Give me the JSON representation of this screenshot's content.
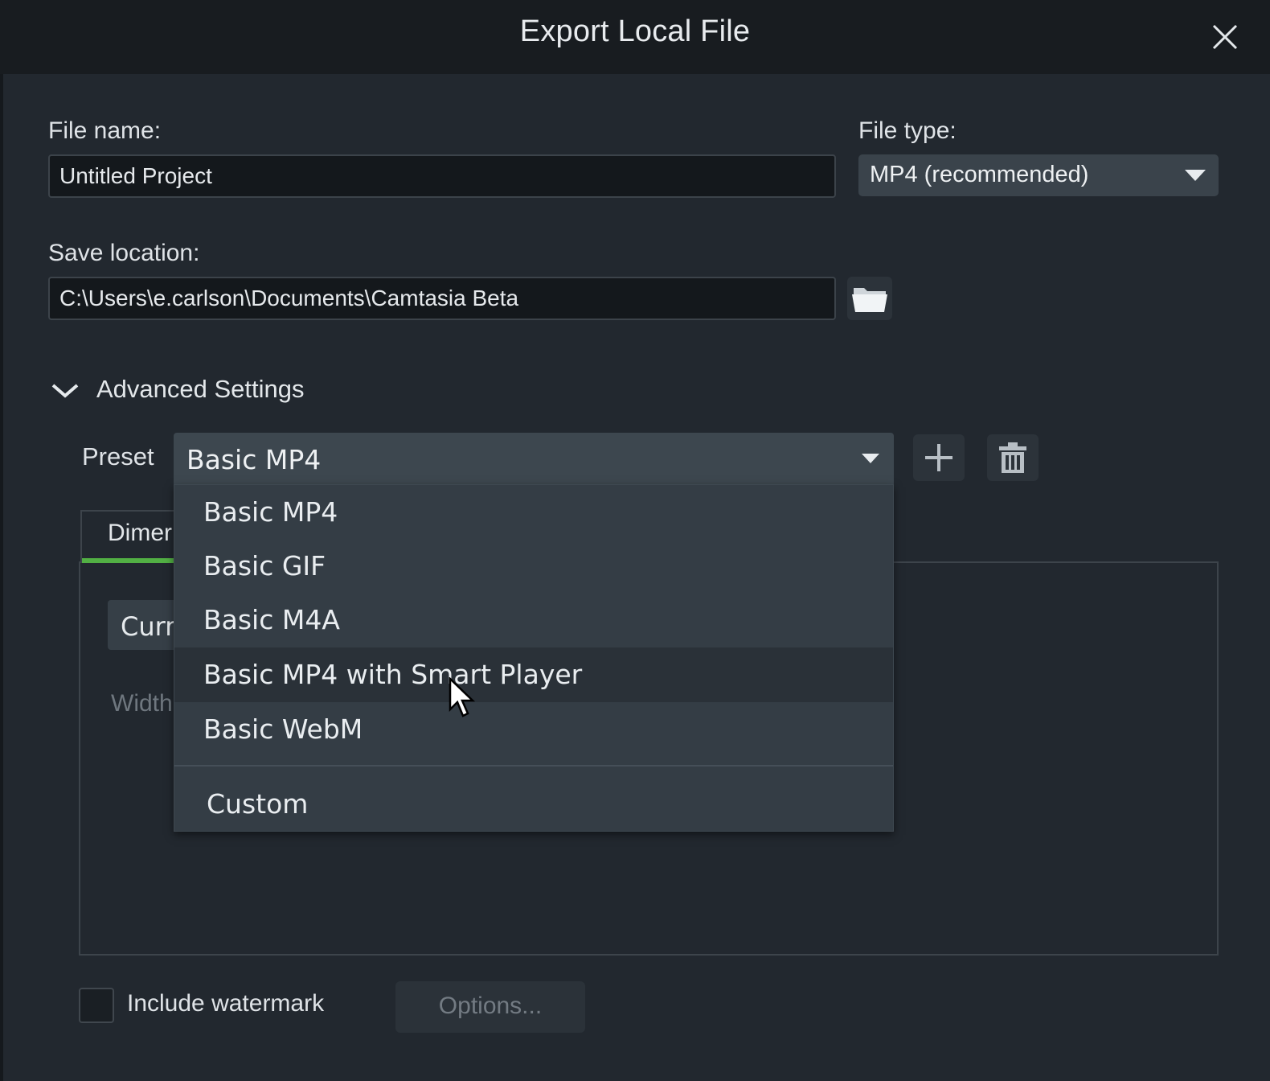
{
  "dialog": {
    "title": "Export Local File"
  },
  "file_name": {
    "label": "File name:",
    "value": "Untitled Project"
  },
  "file_type": {
    "label": "File type:",
    "selected": "MP4 (recommended)"
  },
  "save_location": {
    "label": "Save location:",
    "value": "C:\\Users\\e.carlson\\Documents\\Camtasia Beta"
  },
  "advanced": {
    "label": "Advanced Settings"
  },
  "preset": {
    "label": "Preset",
    "selected": "Basic MP4",
    "options": [
      "Basic MP4",
      "Basic GIF",
      "Basic M4A",
      "Basic MP4 with Smart Player",
      "Basic WebM",
      "Custom"
    ],
    "hovered_option": "Basic MP4 with Smart Player"
  },
  "tabs": {
    "dimensions_partial": "Dimer"
  },
  "panel": {
    "current_partial": "Curr",
    "width_partial": "Width"
  },
  "watermark": {
    "label": "Include watermark",
    "checked": false
  },
  "options_button": {
    "label": "Options...",
    "enabled": false
  },
  "colors": {
    "tab_accent": "#52b044",
    "background": "#22282f",
    "titlebar": "#181c20"
  }
}
